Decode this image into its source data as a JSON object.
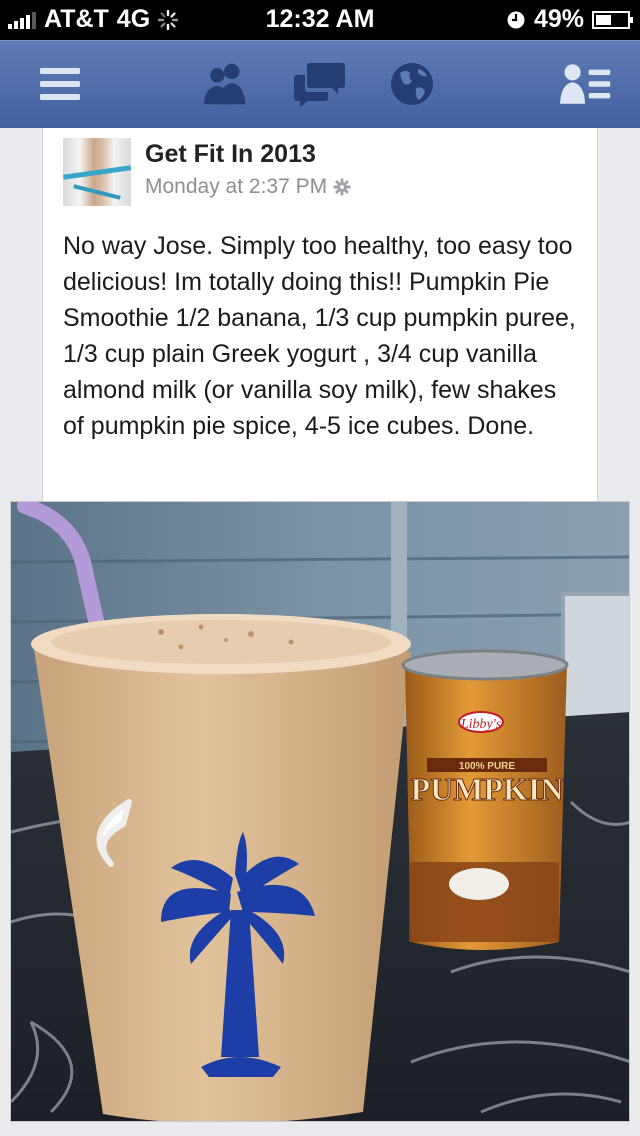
{
  "status_bar": {
    "carrier": "AT&T",
    "network": "4G",
    "time": "12:32 AM",
    "battery": "49%",
    "battery_level": 0.49
  },
  "nav": {
    "icons": [
      "menu-icon",
      "friend-requests-icon",
      "messages-icon",
      "notifications-globe-icon",
      "friends-list-icon"
    ]
  },
  "post": {
    "author": "Get Fit In 2013",
    "timestamp": "Monday at 2:37 PM",
    "text": "No way Jose. Simply too healthy, too easy too delicious! Im totally doing this!! Pumpkin Pie Smoothie 1/2 banana, 1/3 cup pumpkin puree, 1/3 cup plain Greek yogurt , 3/4 cup vanilla almond milk (or vanilla soy milk), few shakes of pumpkin pie spice, 4-5 ice cubes. Done."
  },
  "photo": {
    "can_brand": "Libby's",
    "can_band": "100% PURE",
    "can_label": "PUMPKIN"
  },
  "colors": {
    "nav_top": "#5f7bb5",
    "nav_bottom": "#42619f",
    "background": "#e9ebee"
  }
}
